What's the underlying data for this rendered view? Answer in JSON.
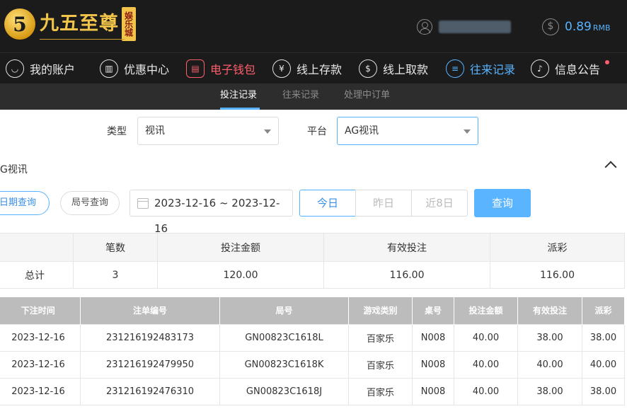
{
  "brand": {
    "logo_char": "5",
    "name": "九五至尊",
    "tag": "娱乐城"
  },
  "account": {
    "balance": "0.89",
    "currency": "RMB"
  },
  "nav": [
    {
      "label": "我的账户",
      "icon": "user-icon"
    },
    {
      "label": "优惠中心",
      "icon": "gift-icon"
    },
    {
      "label": "电子钱包",
      "icon": "wallet-icon"
    },
    {
      "label": "线上存款",
      "icon": "deposit-icon"
    },
    {
      "label": "线上取款",
      "icon": "withdraw-icon"
    },
    {
      "label": "往来记录",
      "icon": "records-icon"
    },
    {
      "label": "信息公告",
      "icon": "bell-icon"
    }
  ],
  "subtabs": [
    "投注记录",
    "往来记录",
    "处理中订单"
  ],
  "filters": {
    "type_label": "类型",
    "type_value": "视讯",
    "platform_label": "平台",
    "platform_value": "AG视讯"
  },
  "section_title": "G视讯",
  "query": {
    "date_query": "日期查询",
    "round_query": "局号查询",
    "date_range": "2023-12-16 ~ 2023-12-16",
    "today": "今日",
    "yesterday": "昨日",
    "last8": "近8日",
    "submit": "查询"
  },
  "summary": {
    "headers": [
      "",
      "笔数",
      "投注金额",
      "有效投注",
      "派彩"
    ],
    "row": [
      "总计",
      "3",
      "120.00",
      "116.00",
      "116.00"
    ]
  },
  "records": {
    "headers": [
      "下注时间",
      "注单编号",
      "局号",
      "游戏类别",
      "桌号",
      "投注金额",
      "有效投注",
      "派彩"
    ],
    "rows": [
      [
        "2023-12-16",
        "231216192483173",
        "GN00823C1618L",
        "百家乐",
        "N008",
        "40.00",
        "38.00",
        "38.00"
      ],
      [
        "2023-12-16",
        "231216192479950",
        "GN00823C1618K",
        "百家乐",
        "N008",
        "40.00",
        "40.00",
        "40.00"
      ],
      [
        "2023-12-16",
        "231216192476310",
        "GN00823C1618J",
        "百家乐",
        "N008",
        "40.00",
        "38.00",
        "38.00"
      ]
    ]
  },
  "colors": {
    "accent": "#58b3ff",
    "wallet": "#ff5e6c",
    "header_bg": "#1b1b1b",
    "gold": "#f2c44a"
  }
}
